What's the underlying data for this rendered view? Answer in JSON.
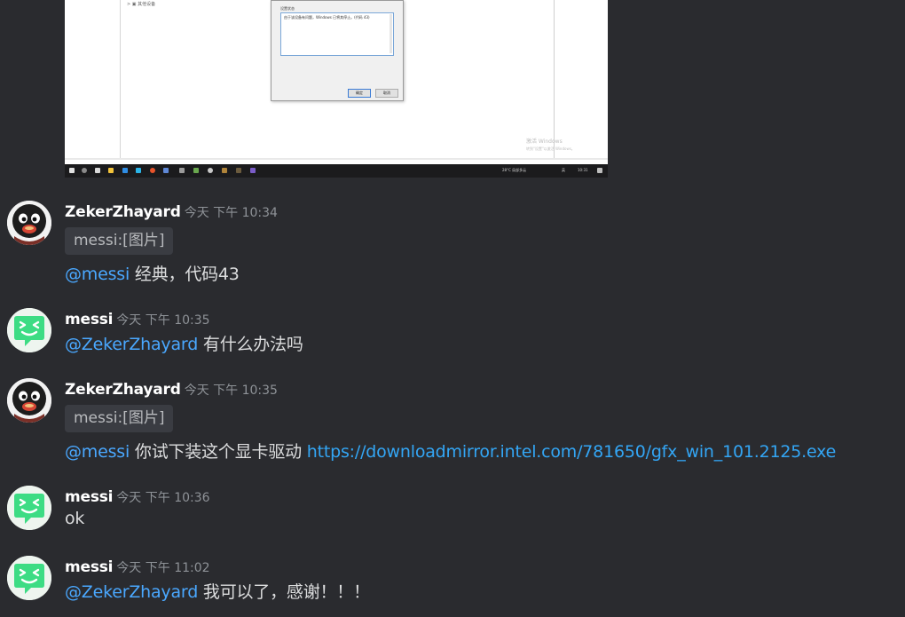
{
  "attachment": {
    "dialog_label": "设置状态",
    "dialog_message": "由于该设备有问题，Windows 已将其停止。(代码 43)",
    "primary_button": "确定",
    "secondary_button": "取消",
    "watermark_line1": "激活 Windows",
    "watermark_line2": "转到\"设置\"以激活 Windows。",
    "tray_weather": "28°C 局部多云",
    "tray_lang": "英",
    "tray_time": "10:31"
  },
  "messages": [
    {
      "author": "ZekerZhayard",
      "timestamp": "今天 下午 10:34",
      "reply_chip": "messi:[图片]",
      "mention": "@messi",
      "text": " 经典，代码43"
    },
    {
      "author": "messi",
      "timestamp": "今天 下午 10:35",
      "mention": "@ZekerZhayard",
      "text": " 有什么办法吗"
    },
    {
      "author": "ZekerZhayard",
      "timestamp": "今天 下午 10:35",
      "reply_chip": "messi:[图片]",
      "mention": "@messi",
      "text": " 你试下装这个显卡驱动 ",
      "link": "https://downloadmirror.intel.com/781650/gfx_win_101.2125.exe"
    },
    {
      "author": "messi",
      "timestamp": "今天 下午 10:36",
      "text": "ok"
    },
    {
      "author": "messi",
      "timestamp": "今天 下午 11:02",
      "mention": "@ZekerZhayard",
      "text": " 我可以了，感谢！！！"
    }
  ],
  "colors": {
    "background": "#2a2b2f",
    "mention": "#4aa8ff",
    "link": "#33a6f5",
    "timestamp": "#8e9297",
    "messi_avatar": "#3ddc84"
  }
}
